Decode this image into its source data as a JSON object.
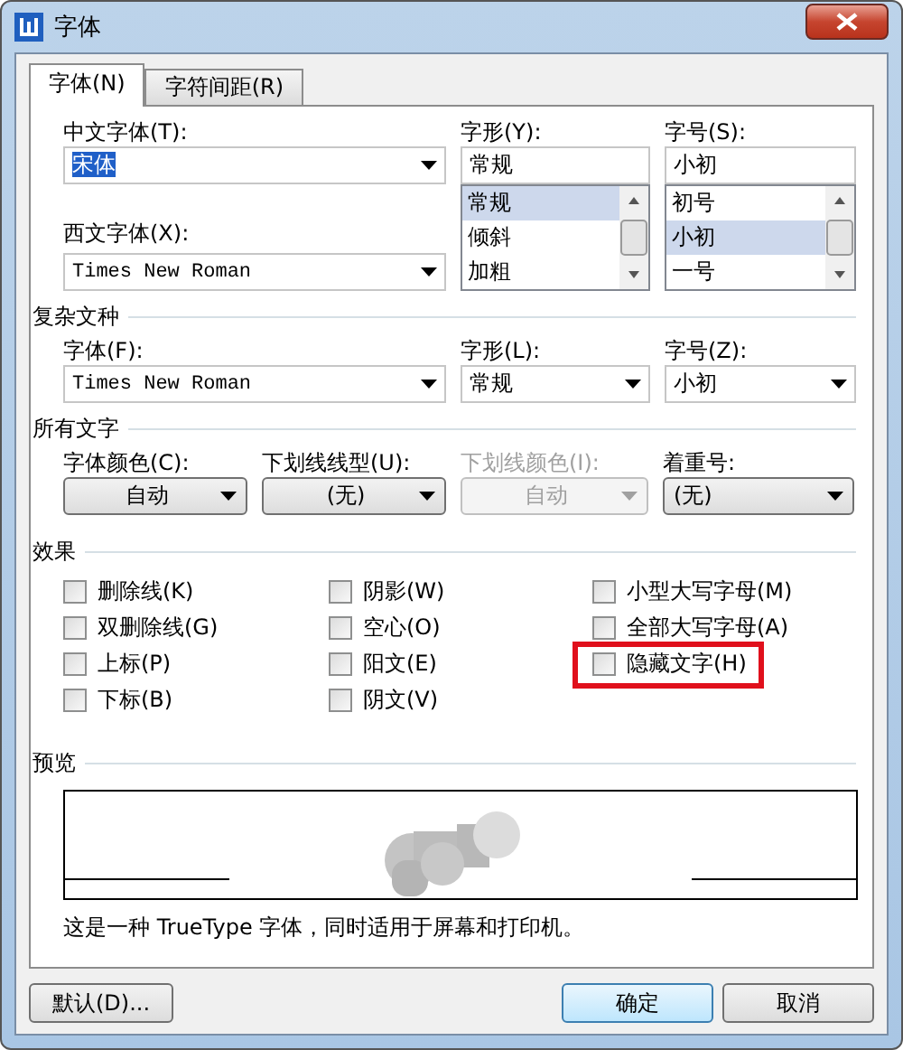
{
  "window": {
    "title": "字体"
  },
  "tabs": [
    {
      "label": "字体(N)",
      "selected": true
    },
    {
      "label": "字符间距(R)",
      "selected": false
    }
  ],
  "chinese_font": {
    "label": "中文字体(T):",
    "value": "宋体",
    "text_selected": true
  },
  "style": {
    "label": "字形(Y):",
    "value": "常规",
    "options": [
      {
        "label": "常规",
        "selected": true
      },
      {
        "label": "倾斜",
        "selected": false
      },
      {
        "label": "加粗",
        "selected": false
      }
    ]
  },
  "size": {
    "label": "字号(S):",
    "value": "小初",
    "options": [
      {
        "label": "初号",
        "selected": false
      },
      {
        "label": "小初",
        "selected": true
      },
      {
        "label": "一号",
        "selected": false
      }
    ]
  },
  "western_font": {
    "label": "西文字体(X):",
    "value": "Times New Roman"
  },
  "complex_script": {
    "title": "复杂文种",
    "fields": [
      {
        "label": "字体(F):",
        "value": "Times New Roman"
      },
      {
        "label": "字形(L):",
        "value": "常规"
      },
      {
        "label": "字号(Z):",
        "value": "小初"
      }
    ]
  },
  "all_text": {
    "title": "所有文字",
    "fields": [
      {
        "label": "字体颜色(C):",
        "value": "自动",
        "kind": "button",
        "disabled": false
      },
      {
        "label": "下划线线型(U):",
        "value": "(无)",
        "kind": "button",
        "disabled": false
      },
      {
        "label": "下划线颜色(I):",
        "value": "自动",
        "kind": "button",
        "disabled": true
      },
      {
        "label": "着重号:",
        "value": "(无)",
        "kind": "combo",
        "disabled": false
      }
    ]
  },
  "effects": {
    "title": "效果",
    "options": [
      {
        "label": "删除线(K)",
        "checked": false,
        "highlighted": false
      },
      {
        "label": "阴影(W)",
        "checked": false,
        "highlighted": false
      },
      {
        "label": "小型大写字母(M)",
        "checked": false,
        "highlighted": false
      },
      {
        "label": "双删除线(G)",
        "checked": false,
        "highlighted": false
      },
      {
        "label": "空心(O)",
        "checked": false,
        "highlighted": false
      },
      {
        "label": "全部大写字母(A)",
        "checked": false,
        "highlighted": false
      },
      {
        "label": "上标(P)",
        "checked": false,
        "highlighted": false
      },
      {
        "label": "阳文(E)",
        "checked": false,
        "highlighted": false
      },
      {
        "label": "隐藏文字(H)",
        "checked": false,
        "highlighted": true
      },
      {
        "label": "下标(B)",
        "checked": false,
        "highlighted": false
      },
      {
        "label": "阴文(V)",
        "checked": false,
        "highlighted": false
      }
    ]
  },
  "preview": {
    "title": "预览",
    "caption": "这是一种 TrueType 字体，同时适用于屏幕和打印机。"
  },
  "buttons": [
    {
      "label": "默认(D)...",
      "kind": "default"
    },
    {
      "label": "确定",
      "kind": "primary"
    },
    {
      "label": "取消",
      "kind": "normal"
    }
  ]
}
